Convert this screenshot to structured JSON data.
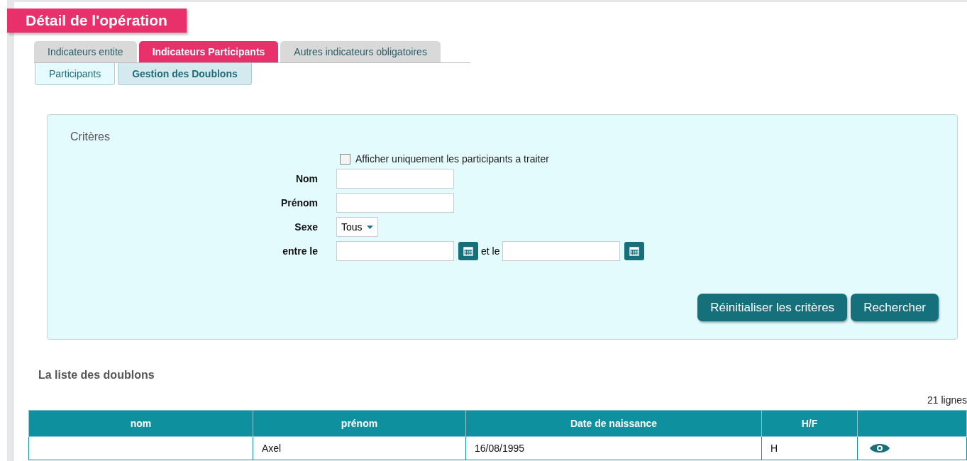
{
  "page_title": "Détail de l'opération",
  "tabs": [
    {
      "label": "Indicateurs entite",
      "selected": false
    },
    {
      "label": "Indicateurs Participants",
      "selected": true
    },
    {
      "label": "Autres indicateurs obligatoires",
      "selected": false
    }
  ],
  "subtabs": [
    {
      "label": "Participants",
      "selected": false
    },
    {
      "label": "Gestion des Doublons",
      "selected": true
    }
  ],
  "criteria": {
    "title": "Critères",
    "checkbox": {
      "label": "Afficher uniquement les participants a traiter",
      "checked": false
    },
    "fields": [
      {
        "kind": "text",
        "label": "Nom"
      },
      {
        "kind": "text",
        "label": "Prénom"
      },
      {
        "kind": "select",
        "label": "Sexe",
        "value": "Tous"
      },
      {
        "kind": "date_range",
        "label": "entre le",
        "separator": "et le"
      }
    ],
    "buttons": [
      "Réinitialiser les critères",
      "Rechercher"
    ]
  },
  "list": {
    "title": "La liste des doublons",
    "count": "21 lignes",
    "columns": [
      "nom",
      "prénom",
      "Date de naissance",
      "H/F"
    ],
    "rows": [
      {
        "prenom": "Axel",
        "date_de_naissance": "16/08/1995",
        "hf": "H"
      }
    ]
  }
}
